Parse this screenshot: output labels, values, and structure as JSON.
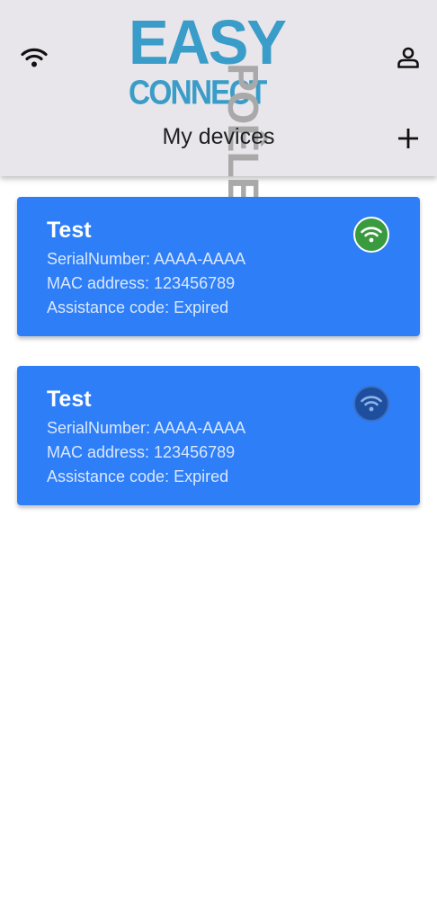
{
  "header": {
    "logo": {
      "line1": "EASY",
      "line2": "CONNECT",
      "side": "POÊLE"
    },
    "title": "My devices",
    "icons": {
      "left": "wifi-icon",
      "right": "account-icon",
      "action": "add-icon"
    }
  },
  "devices": [
    {
      "name": "Test",
      "serial": "SerialNumber: AAAA-AAAA",
      "mac": "MAC address: 123456789",
      "assistance": "Assistance code: Expired",
      "status_icon": "wifi-online-icon",
      "status_color": "#3a9a3e"
    },
    {
      "name": "Test",
      "serial": "SerialNumber: AAAA-AAAA",
      "mac": "MAC address: 123456789",
      "assistance": "Assistance code: Expired",
      "status_icon": "wifi-offline-icon",
      "status_color": "#1e4e9e"
    }
  ],
  "colors": {
    "header_bg": "#e8e6ea",
    "card_bg": "#2d7ef7",
    "logo_blue": "#3a9cc8",
    "logo_gray": "#a9a9a9"
  }
}
